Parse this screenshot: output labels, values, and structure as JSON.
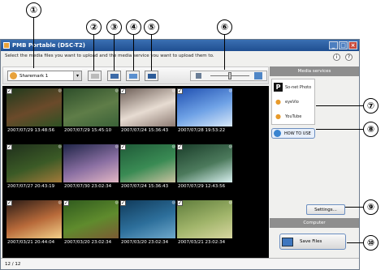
{
  "callouts": [
    "①",
    "②",
    "③",
    "④",
    "⑤",
    "⑥",
    "⑦",
    "⑧",
    "⑨",
    "⑩"
  ],
  "window": {
    "title": "PMB Portable (DSC-T2)",
    "instruction": "Select the media files you want to upload and the media service you want to upload them to.",
    "help_info": "i",
    "help_question": "?",
    "minimize": "_",
    "maximize": "□",
    "close": "×"
  },
  "toolbar": {
    "account_name": "Sharemark 1",
    "account_arrow": "▾",
    "zoom_level": 0.5
  },
  "thumbnails": [
    {
      "timestamp": "2007/07/29 13:48:56",
      "checked": true,
      "colors": [
        "#1f3a1c",
        "#6b4a2a",
        "#2e5224"
      ]
    },
    {
      "timestamp": "2007/07/29 15:45:10",
      "checked": false,
      "colors": [
        "#2d4e2a",
        "#5f7d48",
        "#3a6138"
      ]
    },
    {
      "timestamp": "2007/07/24 15:36:43",
      "checked": true,
      "colors": [
        "#6d5e57",
        "#e7dcd2",
        "#8c7a72"
      ]
    },
    {
      "timestamp": "2007/07/28 19:53:22",
      "checked": true,
      "colors": [
        "#1f4fb0",
        "#6fa2e6",
        "#d8e8f8"
      ]
    },
    {
      "timestamp": "2007/07/27 20:43:19",
      "checked": true,
      "colors": [
        "#1f2f1c",
        "#3b5a26",
        "#a37a3a"
      ]
    },
    {
      "timestamp": "2007/07/30 23:02:34",
      "checked": false,
      "colors": [
        "#1f2548",
        "#8a6fa2",
        "#e3b7c4"
      ]
    },
    {
      "timestamp": "2007/07/24 15:36:43",
      "checked": true,
      "colors": [
        "#1f5a38",
        "#3a8b54",
        "#c9c2a0"
      ]
    },
    {
      "timestamp": "2007/07/29 12:43:56",
      "checked": true,
      "colors": [
        "#1a3d2a",
        "#4c7a5c",
        "#d8f0f0"
      ]
    },
    {
      "timestamp": "2007/03/21 20:44:04",
      "checked": true,
      "colors": [
        "#2a1c16",
        "#b86a3a",
        "#f3d08a"
      ]
    },
    {
      "timestamp": "2007/03/20 23:02:34",
      "checked": true,
      "colors": [
        "#2f5a1e",
        "#5f8b2d",
        "#7c5a34"
      ]
    },
    {
      "timestamp": "2007/03/20 23:02:34",
      "checked": true,
      "colors": [
        "#103a5a",
        "#2d6f9b",
        "#6fa9cc"
      ]
    },
    {
      "timestamp": "2007/03/21 23:02:34",
      "checked": true,
      "colors": [
        "#5f7d3c",
        "#a0b46a",
        "#d8d6a0"
      ]
    }
  ],
  "sidebar": {
    "media_services_header": "Media services",
    "services": [
      {
        "name": "So-net Photo",
        "icon": "sonet-photo-icon",
        "glyph": "P",
        "color": "#111111"
      },
      {
        "name": "eyeVio",
        "icon": "eyevio-icon",
        "glyph": "●",
        "color": "#e89a2a"
      },
      {
        "name": "YouTube",
        "icon": "youtube-icon",
        "glyph": "●",
        "color": "#e89a2a"
      }
    ],
    "how_to_use": "HOW TO USE",
    "settings_button": "Settings...",
    "computer_header": "Computer",
    "save_files_button": "Save Files"
  },
  "status": {
    "count": "12 / 12"
  }
}
